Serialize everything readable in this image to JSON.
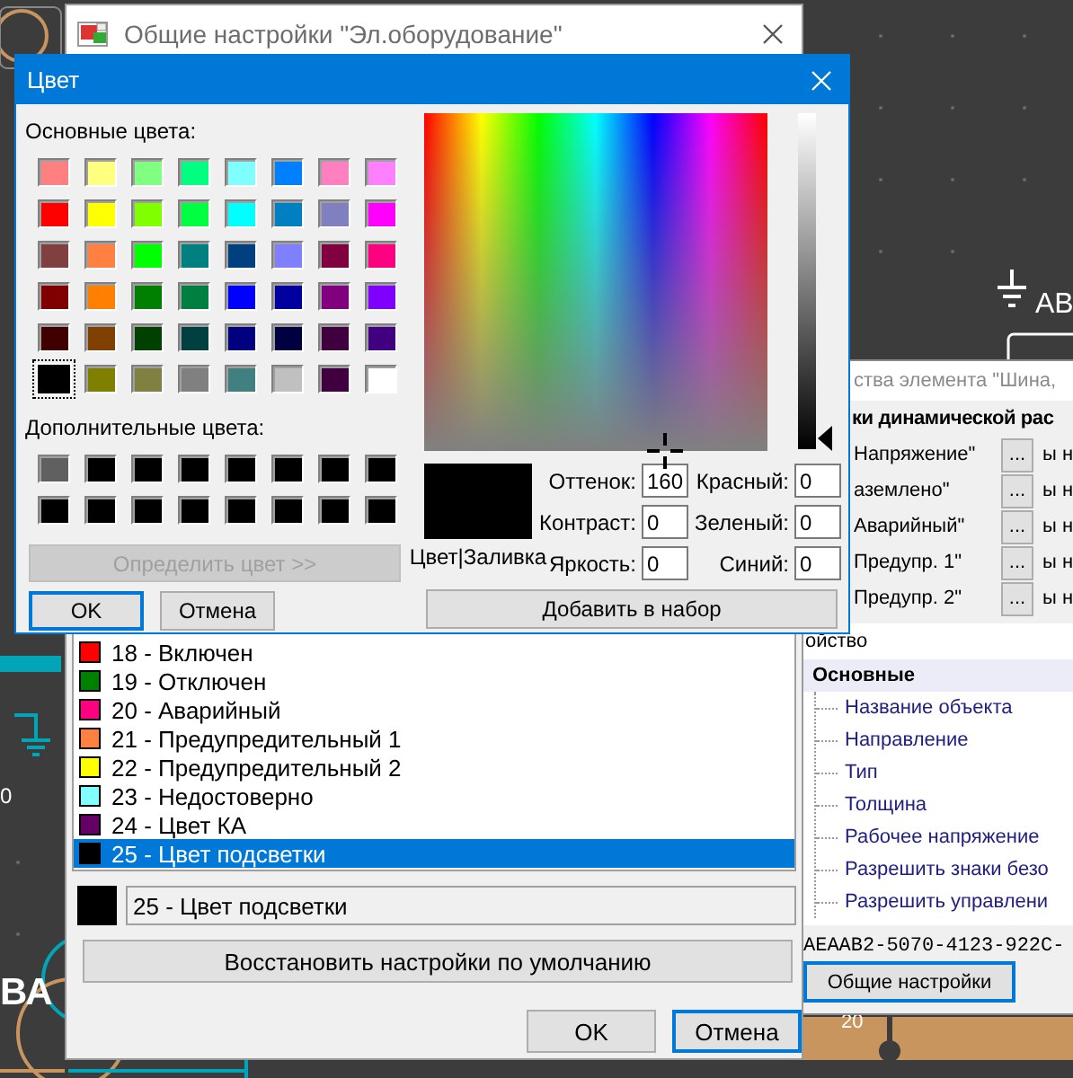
{
  "canvas": {
    "labels": [
      {
        "text": "АВ"
      },
      {
        "text": "0"
      },
      {
        "text": "ВА"
      },
      {
        "text": "20"
      }
    ]
  },
  "properties_window": {
    "title": "ства элемента \"Шина,",
    "section": "ки динамической рас",
    "rows": [
      {
        "label": "Напряжение\"",
        "button": "...",
        "value": "ы н"
      },
      {
        "label": "аземлено\"",
        "button": "...",
        "value": "ы н"
      },
      {
        "label": "Аварийный\"",
        "button": "...",
        "value": "ы н"
      },
      {
        "label": "Предупр. 1\"",
        "button": "...",
        "value": "ы н"
      },
      {
        "label": "Предупр. 2\"",
        "button": "...",
        "value": "ы н"
      }
    ],
    "grid_header": "ойство",
    "category": "Основные",
    "properties": [
      "Название объекта",
      "Направление",
      "Тип",
      "Толщина",
      "Рабочее напряжение",
      "Разрешить знаки безо",
      "Разрешить управлени"
    ],
    "id_text": "AEAAB2-5070-4123-922C-",
    "button": {
      "label": "Общие настройки",
      "focused": true
    }
  },
  "main_window": {
    "title": "Общие настройки \"Эл.оборудование\"",
    "color_list": [
      {
        "label": "18 - Включен",
        "color": "#ff0000",
        "selected": false
      },
      {
        "label": "19 - Отключен",
        "color": "#008000",
        "selected": false
      },
      {
        "label": "20 - Аварийный",
        "color": "#ff0080",
        "selected": false
      },
      {
        "label": "21 - Предупредительный 1",
        "color": "#ff8040",
        "selected": false
      },
      {
        "label": "22 - Предупредительный 2",
        "color": "#ffff00",
        "selected": false
      },
      {
        "label": "23 - Недостоверно",
        "color": "#80ffff",
        "selected": false
      },
      {
        "label": "24 - Цвет КА",
        "color": "#660066",
        "selected": false
      },
      {
        "label": "25 - Цвет подсветки",
        "color": "#000000",
        "selected": true
      }
    ],
    "current": {
      "color": "#000000",
      "value": "25 - Цвет подсветки"
    },
    "reset_button": "Восстановить настройки по умолчанию",
    "buttons": [
      {
        "label": "OK",
        "focused": false
      },
      {
        "label": "Отмена",
        "focused": true
      }
    ]
  },
  "color_dialog": {
    "title": "Цвет",
    "basic_label": "Основные цвета:",
    "basic_colors": [
      {
        "color": "#ff8080",
        "selected": false
      },
      {
        "color": "#ffff80",
        "selected": false
      },
      {
        "color": "#80ff80",
        "selected": false
      },
      {
        "color": "#00ff80",
        "selected": false
      },
      {
        "color": "#80ffff",
        "selected": false
      },
      {
        "color": "#0080ff",
        "selected": false
      },
      {
        "color": "#ff80c0",
        "selected": false
      },
      {
        "color": "#ff80ff",
        "selected": false
      },
      {
        "color": "#ff0000",
        "selected": false
      },
      {
        "color": "#ffff00",
        "selected": false
      },
      {
        "color": "#80ff00",
        "selected": false
      },
      {
        "color": "#00ff40",
        "selected": false
      },
      {
        "color": "#00ffff",
        "selected": false
      },
      {
        "color": "#0080c0",
        "selected": false
      },
      {
        "color": "#8080c0",
        "selected": false
      },
      {
        "color": "#ff00ff",
        "selected": false
      },
      {
        "color": "#804040",
        "selected": false
      },
      {
        "color": "#ff8040",
        "selected": false
      },
      {
        "color": "#00ff00",
        "selected": false
      },
      {
        "color": "#008080",
        "selected": false
      },
      {
        "color": "#004080",
        "selected": false
      },
      {
        "color": "#8080ff",
        "selected": false
      },
      {
        "color": "#800040",
        "selected": false
      },
      {
        "color": "#ff0080",
        "selected": false
      },
      {
        "color": "#800000",
        "selected": false
      },
      {
        "color": "#ff8000",
        "selected": false
      },
      {
        "color": "#008000",
        "selected": false
      },
      {
        "color": "#008040",
        "selected": false
      },
      {
        "color": "#0000ff",
        "selected": false
      },
      {
        "color": "#0000a0",
        "selected": false
      },
      {
        "color": "#800080",
        "selected": false
      },
      {
        "color": "#8000ff",
        "selected": false
      },
      {
        "color": "#400000",
        "selected": false
      },
      {
        "color": "#804000",
        "selected": false
      },
      {
        "color": "#004000",
        "selected": false
      },
      {
        "color": "#004040",
        "selected": false
      },
      {
        "color": "#000080",
        "selected": false
      },
      {
        "color": "#000040",
        "selected": false
      },
      {
        "color": "#400040",
        "selected": false
      },
      {
        "color": "#400080",
        "selected": false
      },
      {
        "color": "#000000",
        "selected": true
      },
      {
        "color": "#808000",
        "selected": false
      },
      {
        "color": "#808040",
        "selected": false
      },
      {
        "color": "#808080",
        "selected": false
      },
      {
        "color": "#408080",
        "selected": false
      },
      {
        "color": "#c0c0c0",
        "selected": false
      },
      {
        "color": "#400040",
        "selected": false
      },
      {
        "color": "#ffffff",
        "selected": false
      }
    ],
    "custom_label": "Дополнительные цвета:",
    "custom_colors": [
      {
        "color": "#606060"
      },
      {
        "color": "#000000"
      },
      {
        "color": "#000000"
      },
      {
        "color": "#000000"
      },
      {
        "color": "#000000"
      },
      {
        "color": "#000000"
      },
      {
        "color": "#000000"
      },
      {
        "color": "#000000"
      },
      {
        "color": "#000000"
      },
      {
        "color": "#000000"
      },
      {
        "color": "#000000"
      },
      {
        "color": "#000000"
      },
      {
        "color": "#000000"
      },
      {
        "color": "#000000"
      },
      {
        "color": "#000000"
      },
      {
        "color": "#000000"
      }
    ],
    "define_button": {
      "label": "Определить цвет >>",
      "disabled": true
    },
    "buttons": [
      {
        "label": "OK",
        "focused": true
      },
      {
        "label": "Отмена",
        "focused": false
      }
    ],
    "brightness_slider": {
      "level": 0
    },
    "preview_label": "Цвет|Заливка",
    "fields": [
      {
        "label": "Оттенок:",
        "value": "160"
      },
      {
        "label": "Красный:",
        "value": "0"
      },
      {
        "label": "Контраст:",
        "value": "0"
      },
      {
        "label": "Зеленый:",
        "value": "0"
      },
      {
        "label": "Яркость:",
        "value": "0"
      },
      {
        "label": "Синий:",
        "value": "0"
      }
    ],
    "add_button": "Добавить в набор"
  }
}
